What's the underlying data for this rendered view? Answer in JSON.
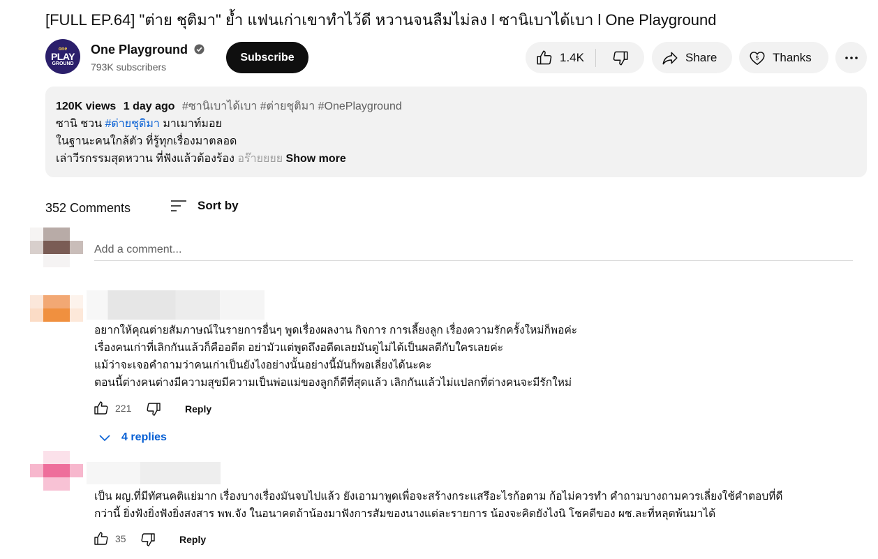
{
  "video": {
    "title": "[FULL EP.64] \"ต่าย ชุติมา\" ย้ำ แฟนเก่าเขาทำไว้ดี หวานจนลืมไม่ลง l ซานิเบาได้เบา l One Playground"
  },
  "channel": {
    "logo_line1": "one",
    "logo_line2": "PLAY",
    "logo_line3": "GROUND",
    "name": "One Playground",
    "subscribers": "793K subscribers",
    "subscribe_label": "Subscribe",
    "verified_icon": "verified-check-icon"
  },
  "actions": {
    "likes": "1.4K",
    "share_label": "Share",
    "thanks_label": "Thanks"
  },
  "description": {
    "views": "120K views",
    "date": "1 day ago",
    "hashtags": "#ซานิเบาได้เบา #ต่ายชุติมา #OnePlayground",
    "line1_a": "ซานิ ชวน ",
    "line1_link": "#ต่ายชุติมา",
    "line1_b": " มาเมาท์มอย",
    "line2": "ในฐานะคนใกล้ตัว ที่รู้ทุกเรื่องมาตลอด",
    "line3": "เล่าวีรกรรมสุดหวาน ที่ฟังแล้วต้องร้อง ",
    "line3_fade": "อร๊ายยยย",
    "show_more": "Show more"
  },
  "comments_header": {
    "count": "352 Comments",
    "sort_label": "Sort by",
    "add_placeholder": "Add a comment..."
  },
  "comments": [
    {
      "lines": [
        "อยากให้คุณต่ายสัมภาษณ์ในรายการอื่นๆ พูดเรื่องผลงาน กิจการ การเลี้ยงลูก เรื่องความรักครั้งใหม่ก็พอค่ะ",
        "เรื่องคนเก่าที่เลิกกันแล้วก็คืออดีต อย่ามัวแต่พูดถึงอดีตเลยมันดูไม่ได้เป็นผลดีกับใครเลยค่ะ",
        "แม้ว่าจะเจอคำถามว่าคนเก่าเป็นยังไงอย่างนั้นอย่างนี้มันก็พอเลี่ยงได้นะคะ",
        "ตอนนี้ต่างคนต่างมีความสุขมีความเป็นพ่อแม่ของลูกก็ดีที่สุดแล้ว เลิกกันแล้วไม่แปลกที่ต่างคนจะมีรักใหม่"
      ],
      "likes": "221",
      "reply_label": "Reply",
      "replies_label": "4 replies"
    },
    {
      "lines": [
        "เป็น ผญ.ที่มีทัศนคติแย่มาก เรื่องบางเรื่องมันจบไปแล้ว ยังเอามาพูดเพื่อจะสร้างกระแสรึอะไรก้อตาม ก้อไม่ควรทำ คำถามบางถามควรเลี่ยงใช้คำตอบที่ดี",
        "กว่านี้ ยิ่งฟังยิ่งฟังยิ่งสงสาร พพ.จัง ในอนาคตถ้าน้องมาฟังการสัมของนางแต่ละรายการ น้องจะคิดยังไงนิ โชคดีของ ผช.ละที่หลุดพ้นมาได้"
      ],
      "likes": "35",
      "reply_label": "Reply"
    }
  ],
  "colors": {
    "accent_link": "#065fd4",
    "pill_bg": "#f2f2f2",
    "subscribe_bg": "#0f0f0f"
  }
}
